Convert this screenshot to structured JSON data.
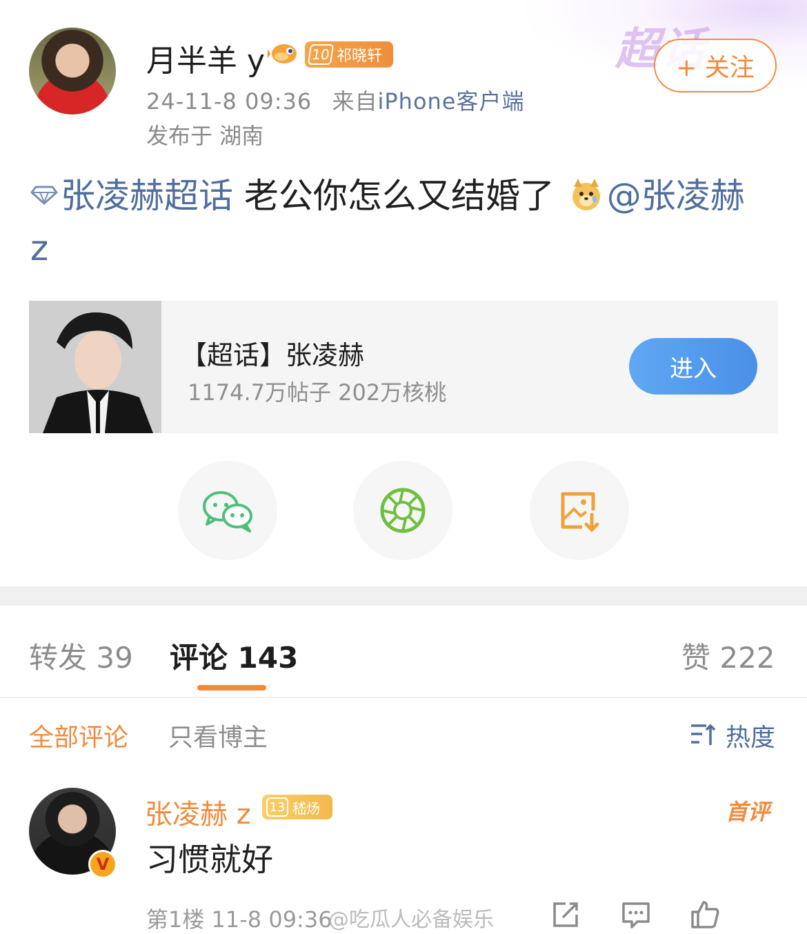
{
  "post": {
    "username": "月半羊 y",
    "badge_level": "10",
    "badge_name": "祁晓轩",
    "time": "24-11-8 09:36",
    "from_prefix": "来自",
    "source": "iPhone客户端",
    "location": "发布于 湖南",
    "follow_label": "+ 关注",
    "deco_label": "超话",
    "topic_link": "张凌赫超话",
    "text": " 老公你怎么又结婚了 ",
    "mention": "@张凌赫",
    "mention_tail": "z"
  },
  "topic_card": {
    "title": "【超话】张凌赫",
    "stats": "1174.7万帖子 202万核桃",
    "enter_label": "进入"
  },
  "share": {
    "items": [
      "wechat-icon",
      "moments-icon",
      "save-image-icon"
    ]
  },
  "tabs": {
    "repost": "转发 39",
    "comments": "评论 143",
    "likes": "赞 222"
  },
  "filters": {
    "all": "全部评论",
    "author_only": "只看博主",
    "sort": "热度"
  },
  "comment": {
    "username": "张凌赫 z",
    "badge_level": "13",
    "badge_name": "嵇炀",
    "first_label": "首评",
    "text": "习惯就好",
    "meta": "第1楼 11-8 09:36",
    "watermark": "@吃瓜人必备娱乐"
  },
  "colors": {
    "accent_orange": "#f28a3c",
    "link_blue": "#4f6e9e",
    "enter_blue": "#4a90e8"
  }
}
